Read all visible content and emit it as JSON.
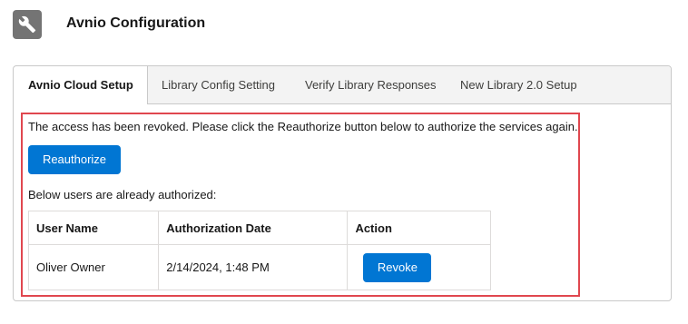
{
  "header": {
    "title": "Avnio Configuration",
    "icon": "wrench-icon",
    "icon_bg": "#747474"
  },
  "tabs": [
    {
      "label": "Avnio Cloud Setup",
      "active": true
    },
    {
      "label": "Library Config Setting",
      "active": false
    },
    {
      "label": "Verify Library Responses",
      "active": false
    },
    {
      "label": "New Library 2.0 Setup",
      "active": false
    }
  ],
  "content": {
    "notice": "The access has been revoked. Please click the Reauthorize button below to authorize the services again.",
    "reauthorize_label": "Reauthorize",
    "authorized_text": "Below users are already authorized:",
    "table": {
      "headers": [
        "User Name",
        "Authorization Date",
        "Action"
      ],
      "rows": [
        {
          "user": "Oliver Owner",
          "date": "2/14/2024, 1:48 PM",
          "action": "Revoke"
        }
      ]
    }
  },
  "colors": {
    "accent": "#0176d3",
    "highlight_border": "#e0474f"
  }
}
